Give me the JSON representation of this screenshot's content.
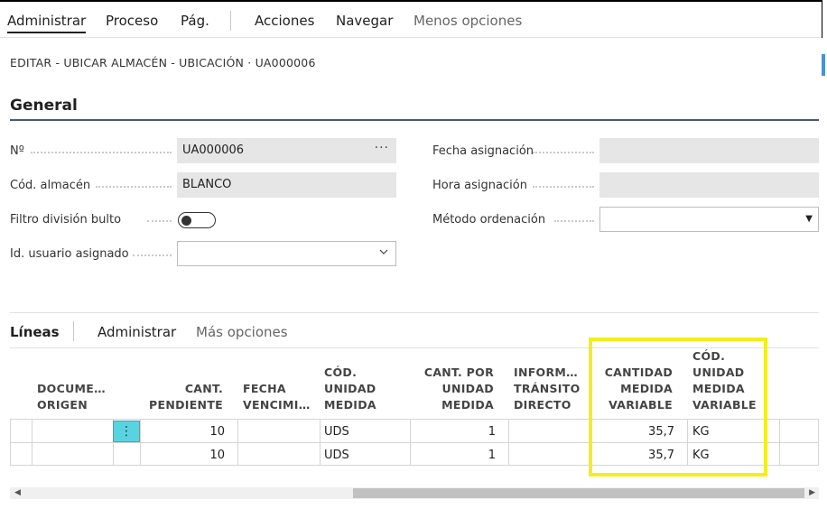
{
  "actions": {
    "administrar": "Administrar",
    "proceso": "Proceso",
    "pag": "Pág.",
    "acciones": "Acciones",
    "navegar": "Navegar",
    "menos_opciones": "Menos opciones"
  },
  "breadcrumb": "EDITAR - UBICAR ALMACÉN - UBICACIÓN · UA000006",
  "general": {
    "title": "General",
    "no_label": "Nº",
    "no_value": "UA000006",
    "cod_almacen_label": "Cód. almacén",
    "cod_almacen_value": "BLANCO",
    "filtro_label": "Filtro división bulto",
    "usuario_label": "Id. usuario asignado",
    "usuario_value": "",
    "fecha_label": "Fecha asignación",
    "fecha_value": "",
    "hora_label": "Hora asignación",
    "hora_value": "",
    "metodo_label": "Método ordenación",
    "metodo_value": ""
  },
  "lines": {
    "title": "Líneas",
    "administrar": "Administrar",
    "mas_opciones": "Más opciones",
    "headers": {
      "documento": [
        "DOCUME…",
        "ORIGEN"
      ],
      "cant_pendiente": [
        "CANT.",
        "PENDIENTE"
      ],
      "fecha": [
        "FECHA",
        "VENCIMI…"
      ],
      "cod_unidad": [
        "CÓD.",
        "UNIDAD",
        "MEDIDA"
      ],
      "cant_por": [
        "CANT. POR",
        "UNIDAD",
        "MEDIDA"
      ],
      "inform": [
        "INFORM…",
        "TRÁNSITO",
        "DIRECTO"
      ],
      "cantidad_variable": [
        "CANTIDAD",
        "MEDIDA",
        "VARIABLE"
      ],
      "cod_variable": [
        "CÓD.",
        "UNIDAD",
        "MEDIDA",
        "VARIABLE"
      ]
    },
    "rows": [
      {
        "documento": "",
        "cant_pendiente": "10",
        "fecha": "",
        "cod_unidad": "UDS",
        "cant_por": "1",
        "inform": "",
        "cantidad_variable": "35,7",
        "cod_variable": "KG"
      },
      {
        "documento": "",
        "cant_pendiente": "10",
        "fecha": "",
        "cod_unidad": "UDS",
        "cant_por": "1",
        "inform": "",
        "cantidad_variable": "35,7",
        "cod_variable": "KG"
      }
    ]
  },
  "colors": {
    "highlight": "#f2ef1d",
    "row_menu": "#5ad3e0"
  },
  "icons": {
    "ellipsis": "ellipsis-icon",
    "chevron": "chevron-down-icon",
    "dropdown": "triangle-down-icon",
    "row_menu": "vertical-dots-icon"
  }
}
